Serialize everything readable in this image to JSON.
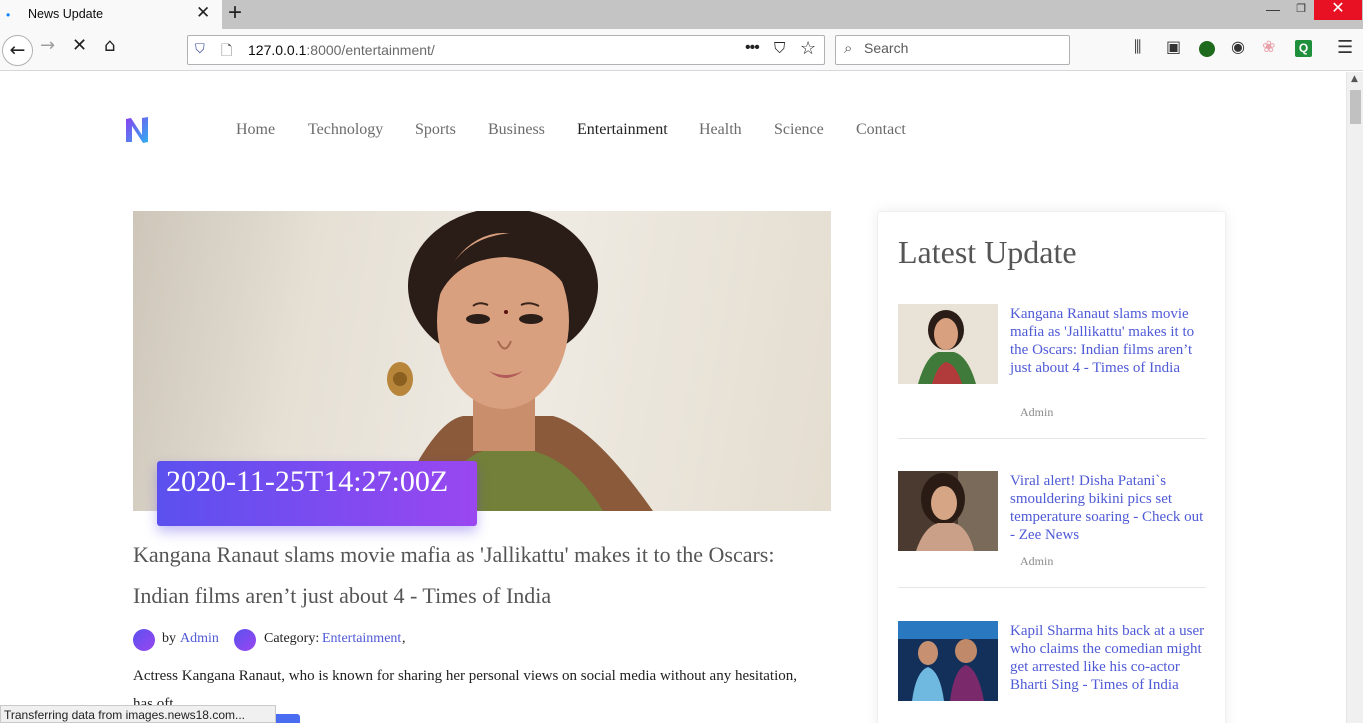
{
  "browser": {
    "tab_title": "News Update",
    "url_host": "127.0.0.1",
    "url_rest": ":8000/entertainment/",
    "search_placeholder": "Search",
    "status_text": "Transferring data from images.news18.com..."
  },
  "site": {
    "nav": [
      {
        "label": "Home"
      },
      {
        "label": "Technology"
      },
      {
        "label": "Sports"
      },
      {
        "label": "Business"
      },
      {
        "label": "Entertainment"
      },
      {
        "label": "Health"
      },
      {
        "label": "Science"
      },
      {
        "label": "Contact"
      }
    ],
    "active_nav": "Entertainment"
  },
  "article": {
    "date": "2020-11-25T14:27:00Z",
    "title": "Kangana Ranaut slams movie mafia as 'Jallikattu' makes it to the Oscars: Indian films aren’t just about 4 - Times of India",
    "by_label": "by",
    "author": "Admin",
    "category_label": "Category:",
    "category": "Entertainment",
    "category_suffix": ",",
    "excerpt": "Actress Kangana Ranaut, who is known for sharing her personal views on social media without any hesitation, has oft..."
  },
  "sidebar": {
    "heading": "Latest Update",
    "posts": [
      {
        "title": "Kangana Ranaut slams movie mafia as 'Jallikattu' makes it to the Oscars: Indian films aren’t just about 4 - Times of India",
        "author": "Admin"
      },
      {
        "title": "Viral alert! Disha Patani`s smouldering bikini pics set temperature soaring - Check out - Zee News",
        "author": "Admin"
      },
      {
        "title": "Kapil Sharma hits back at a user who claims the comedian might get arrested like his co-actor Bharti Sing - Times of India",
        "author": ""
      }
    ]
  },
  "colors": {
    "accent_link": "#4f5ad6",
    "badge_gradient_start": "#5b50ef",
    "badge_gradient_end": "#9a47f0",
    "close_button": "#e81123"
  }
}
